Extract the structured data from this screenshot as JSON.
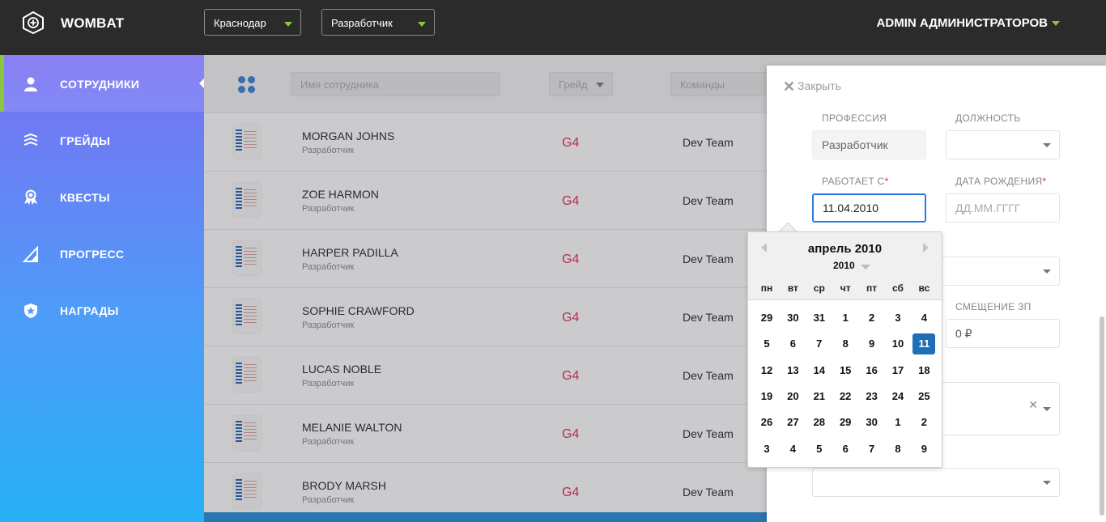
{
  "header": {
    "brand": "WOMBAT",
    "city_select": "Краснодар",
    "role_select": "Разработчик",
    "user": "ADMIN АДМИНИСТРАТОРОВ"
  },
  "sidebar": {
    "items": [
      {
        "label": "СОТРУДНИКИ",
        "icon": "user-icon",
        "active": true
      },
      {
        "label": "ГРЕЙДЫ",
        "icon": "layers-icon"
      },
      {
        "label": "КВЕСТЫ",
        "icon": "badge-icon"
      },
      {
        "label": "ПРОГРЕСС",
        "icon": "progress-icon"
      },
      {
        "label": "НАГРАДЫ",
        "icon": "shield-star-icon"
      }
    ]
  },
  "filters": {
    "name_placeholder": "Имя сотрудника",
    "grade_placeholder": "Грейд",
    "teams_placeholder": "Команды"
  },
  "employees": [
    {
      "name": "MORGAN JOHNS",
      "role": "Разработчик",
      "grade": "G4",
      "team": "Dev Team"
    },
    {
      "name": "ZOE HARMON",
      "role": "Разработчик",
      "grade": "G4",
      "team": "Dev Team"
    },
    {
      "name": "HARPER PADILLA",
      "role": "Разработчик",
      "grade": "G4",
      "team": "Dev Team"
    },
    {
      "name": "SOPHIE CRAWFORD",
      "role": "Разработчик",
      "grade": "G4",
      "team": "Dev Team"
    },
    {
      "name": "LUCAS NOBLE",
      "role": "Разработчик",
      "grade": "G4",
      "team": "Dev Team"
    },
    {
      "name": "MELANIE WALTON",
      "role": "Разработчик",
      "grade": "G4",
      "team": "Dev Team"
    },
    {
      "name": "BRODY MARSH",
      "role": "Разработчик",
      "grade": "G4",
      "team": "Dev Team"
    }
  ],
  "panel": {
    "close_label": "Закрыть",
    "profession_label": "ПРОФЕССИЯ",
    "profession_value": "Разработчик",
    "position_label": "ДОЛЖНОСТЬ",
    "position_value": "",
    "works_since_label": "РАБОТАЕТ С",
    "works_since_value": "11.04.2010",
    "birth_label": "ДАТА РОЖДЕНИЯ",
    "birth_placeholder": "ДД.ММ.ГГГГ",
    "required_mark": "*",
    "salary_offset_label": "СМЕЩЕНИЕ ЗП",
    "salary_offset_value": "0 ₽"
  },
  "datepicker": {
    "month_title": "апрель 2010",
    "year": "2010",
    "weekdays": [
      "пн",
      "вт",
      "ср",
      "чт",
      "пт",
      "сб",
      "вс"
    ],
    "weeks": [
      [
        "29",
        "30",
        "31",
        "1",
        "2",
        "3",
        "4"
      ],
      [
        "5",
        "6",
        "7",
        "8",
        "9",
        "10",
        "11"
      ],
      [
        "12",
        "13",
        "14",
        "15",
        "16",
        "17",
        "18"
      ],
      [
        "19",
        "20",
        "21",
        "22",
        "23",
        "24",
        "25"
      ],
      [
        "26",
        "27",
        "28",
        "29",
        "30",
        "1",
        "2"
      ],
      [
        "3",
        "4",
        "5",
        "6",
        "7",
        "8",
        "9"
      ]
    ],
    "selected_day": "11"
  },
  "colors": {
    "accent_green": "#8cc63f",
    "grade_red": "#e0245e",
    "selected_blue": "#1f6fb5",
    "focus_blue": "#2c7be5"
  }
}
